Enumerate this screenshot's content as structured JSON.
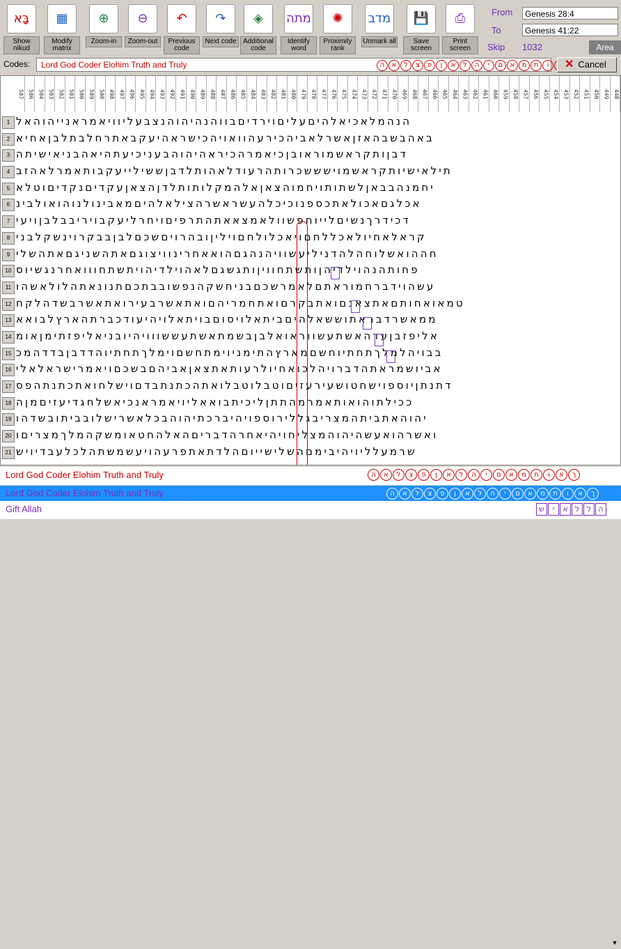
{
  "toolbar": {
    "buttons": [
      {
        "label": "Show nikud",
        "icon": "nikud-icon",
        "glyph": "בָּא"
      },
      {
        "label": "Modify matrix",
        "icon": "matrix-icon",
        "glyph": "▦"
      },
      {
        "label": "Zoom-in",
        "icon": "zoom-in-icon",
        "glyph": "⊕"
      },
      {
        "label": "Zoom-out",
        "icon": "zoom-out-icon",
        "glyph": "⊖"
      },
      {
        "label": "Previous code",
        "icon": "previous-code-icon",
        "glyph": "↶"
      },
      {
        "label": "Next code",
        "icon": "next-code-icon",
        "glyph": "↷"
      },
      {
        "label": "Additional code",
        "icon": "additional-code-icon",
        "glyph": "◈"
      },
      {
        "label": "Identify word",
        "icon": "identify-word-icon",
        "glyph": "מתה"
      },
      {
        "label": "Proximity rank",
        "icon": "proximity-rank-icon",
        "glyph": "✺"
      },
      {
        "label": "Unmark all",
        "icon": "unmark-all-icon",
        "glyph": "מדב"
      },
      {
        "label": "Save screen",
        "icon": "save-screen-icon",
        "glyph": "💾"
      },
      {
        "label": "Print screen",
        "icon": "print-screen-icon",
        "glyph": "⎙"
      }
    ]
  },
  "range": {
    "from_label": "From",
    "from_value": "Genesis 28:4",
    "to_label": "To",
    "to_value": "Genesis 41:22",
    "skip_label": "Skip",
    "skip_value": "1032",
    "area_label": "Area"
  },
  "codes": {
    "label": "Codes:",
    "value": "Lord God Coder Elohim Truth and Truly",
    "hebrew": [
      "ה",
      "א",
      "ל",
      "צ",
      "פ",
      "ן",
      "א",
      "ל",
      "ה",
      "י",
      "ם",
      "א",
      "מ",
      "ת",
      "ו",
      "א",
      "ך"
    ],
    "cancel_label": "Cancel"
  },
  "columns": [
    "507",
    "506",
    "504",
    "503",
    "502",
    "501",
    "500",
    "509",
    "508",
    "498",
    "497",
    "496",
    "495",
    "494",
    "493",
    "492",
    "491",
    "490",
    "489",
    "488",
    "487",
    "486",
    "485",
    "484",
    "483",
    "482",
    "481",
    "480",
    "479",
    "478",
    "477",
    "476",
    "475",
    "474",
    "473",
    "472",
    "471",
    "470",
    "469",
    "468",
    "467",
    "466",
    "465",
    "464",
    "463",
    "462",
    "461",
    "460",
    "459",
    "458",
    "457",
    "456",
    "455",
    "454",
    "453",
    "452",
    "451",
    "450",
    "449",
    "448",
    "447",
    "446",
    "445",
    "444"
  ],
  "rows": [
    {
      "n": "1",
      "t": "הנהמלאכיאלהיםעליםוירדיםבווהנהיהוהנצבעליוויאמראנייהוהאל"
    },
    {
      "n": "2",
      "t": "באהבשבהאזןאשרלאביהכירעהוואויהכישראהיעקבאתרחלבתלבןאחיא"
    },
    {
      "n": "3",
      "t": "דבןותקראשמוראובןכיאמרהכיראהיהוהבעניכיעתהיאהבניאישיתה"
    },
    {
      "n": "4",
      "t": "תילאישיותקראשמוישששכרותהרעודלאהותלדבןששילייעקבותאמרלאהזב"
    },
    {
      "n": "5",
      "t": "יחמנהבבאןלשתותויחמוהצאןאלהמקלותותלדןהצאןעקדיםנקדיםוטלא"
    },
    {
      "n": "6",
      "t": "אכלגםאכולאתכספנוכיכלהעשראשרהצילאלהיםמאבינולנוהואולבינ"
    },
    {
      "n": "7",
      "t": "דכידרךנשיםלייוחפשוולאמצאאתהתרפיםויחרליעקבויריבבלבןויעי"
    },
    {
      "n": "8",
      "t": "קראלאחיולאכללחםויאכלולחםויליןובהרויםשכםלבןבבקרוינשקלבני"
    },
    {
      "n": "9",
      "t": "חההואשלוחהלהדניליעשוויהנהגםהואאחרינוויצוגםאתהשניגםאתהשלי"
    },
    {
      "n": "10",
      "t": "פחותהנהוילדיהןותשתחוויןותגשגםלאהוילדיהויתשתחווואחרנגשיוס"
    },
    {
      "n": "11",
      "t": "עשהוידברחמוראתםלאמרשכםבניחשקהנפשובבתכםתנונאתהלולאשהו"
    },
    {
      "n": "12",
      "t": "טמאואחותםאתצאנםואתבקרםואתחמריהםואתאשרבעירואתאשרבשדהלקח"
    },
    {
      "n": "13",
      "t": "ממאשרדבראתוששאלהיםביתאלויסוםבויתאלויהיעודכברתהארץלבואא"
    },
    {
      "n": "14",
      "t": "אליפזבןעדהאשתעשווראואלבןבשמתאשתעששווויהיובניאליפזתימןאומ"
    },
    {
      "n": "15",
      "t": "בבויהלמלךתחתיוחשםמארץהתימניוימתחשםוימלךתחתיוהדדבןבדדהמכ"
    },
    {
      "n": "16",
      "t": "אביושמראתהדברויהלכואחיולרעותאתצאןאביהםבשכםויאמרישראלאלי"
    },
    {
      "n": "17",
      "t": "דתנתןיוספוישחטושעירעזיםוטבלוטבלואתהכתנתבדםוישלחואתכתנתהפס"
    },
    {
      "n": "18",
      "t": "ככילתוהואותאמרמהתתןליכיתבואאליויאמראנכיאשלחגדיעזיםמןה"
    },
    {
      "n": "19",
      "t": "יהוהאתביתהמצריבגללירוספויהיברכתיהוהבכלאשרישלובביתובשדהו"
    },
    {
      "n": "20",
      "t": "ואשרהואעשהיהוהמצליחויהיאחרהדבריםהאלהחטאומשקהמלךמצריםו"
    },
    {
      "n": "21",
      "t": "שרמעלליויהיבימםהשלישייוםהלדתאתפרעהויעשמשתהלכלעבדיויש"
    }
  ],
  "results": [
    {
      "text": "Lord God Coder Elohim Truth and Truly",
      "hebrew": [
        "ה",
        "א",
        "ל",
        "צ",
        "פ",
        "ן",
        "א",
        "ל",
        "ה",
        "י",
        "ם",
        "א",
        "מ",
        "ת",
        "ו",
        "א",
        "ך"
      ]
    },
    {
      "text": "Lord God Coder Elohim Truth and Truly",
      "hebrew": [
        "ה",
        "א",
        "ל",
        "צ",
        "פ",
        "ן",
        "א",
        "ל",
        "ה",
        "י",
        "ם",
        "א",
        "מ",
        "ת",
        "ו",
        "א",
        "ך"
      ]
    },
    {
      "text": "Gift Allah",
      "hebrew": [
        "ש",
        "י",
        "א",
        "ל",
        "ל",
        "ה"
      ]
    }
  ]
}
